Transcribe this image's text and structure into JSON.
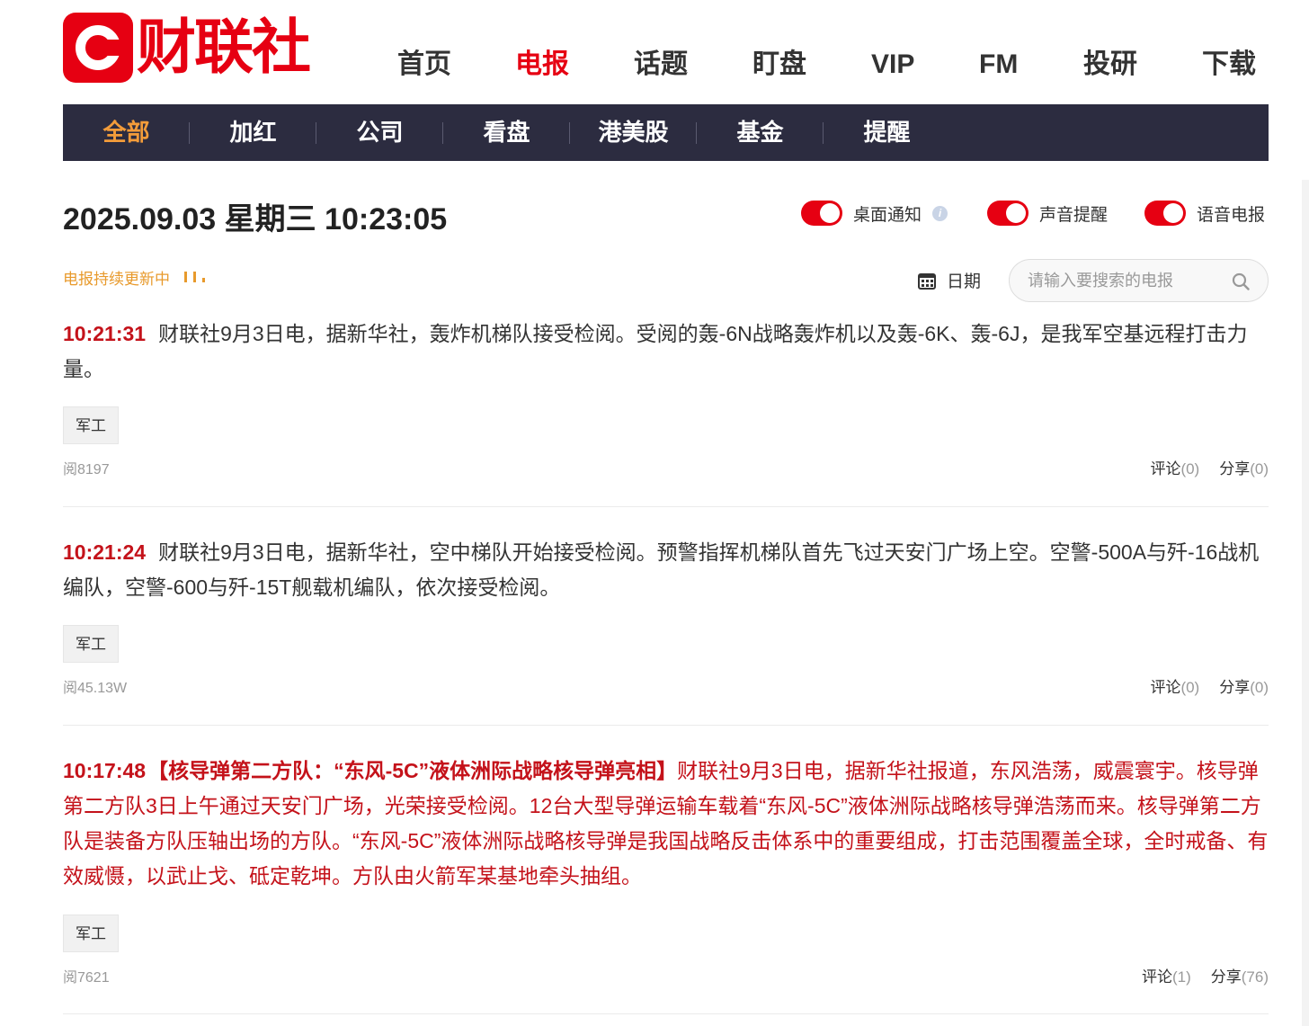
{
  "brand": {
    "name": "财联社",
    "color": "#e60012"
  },
  "main_nav": [
    {
      "label": "首页"
    },
    {
      "label": "电报",
      "active": true
    },
    {
      "label": "话题"
    },
    {
      "label": "盯盘"
    },
    {
      "label": "VIP"
    },
    {
      "label": "FM"
    },
    {
      "label": "投研"
    },
    {
      "label": "下载"
    }
  ],
  "sub_nav": [
    {
      "label": "全部",
      "active": true
    },
    {
      "label": "加红"
    },
    {
      "label": "公司"
    },
    {
      "label": "看盘"
    },
    {
      "label": "港美股"
    },
    {
      "label": "基金"
    },
    {
      "label": "提醒"
    }
  ],
  "date_display": "2025.09.03 星期三 10:23:05",
  "toggles": [
    {
      "label": "桌面通知",
      "on": true,
      "has_info_icon": true
    },
    {
      "label": "声音提醒",
      "on": true
    },
    {
      "label": "语音电报",
      "on": true
    }
  ],
  "status": {
    "updating_text": "电报持续更新中"
  },
  "date_filter_label": "日期",
  "search": {
    "placeholder": "请输入要搜索的电报"
  },
  "telegrams": [
    {
      "time": "10:21:31",
      "headline": "",
      "text": "财联社9月3日电，据新华社，轰炸机梯队接受检阅。受阅的轰-6N战略轰炸机以及轰-6K、轰-6J，是我军空基远程打击力量。",
      "tag": "军工",
      "reads": "阅8197",
      "comment_label": "评论",
      "comment_count": "(0)",
      "share_label": "分享",
      "share_count": "(0)",
      "highlight": false
    },
    {
      "time": "10:21:24",
      "headline": "",
      "text": "财联社9月3日电，据新华社，空中梯队开始接受检阅。预警指挥机梯队首先飞过天安门广场上空。空警-500A与歼-16战机编队，空警-600与歼-15T舰载机编队，依次接受检阅。",
      "tag": "军工",
      "reads": "阅45.13W",
      "comment_label": "评论",
      "comment_count": "(0)",
      "share_label": "分享",
      "share_count": "(0)",
      "highlight": false
    },
    {
      "time": "10:17:48",
      "headline": "【核导弹第二方队：“东风-5C”液体洲际战略核导弹亮相】",
      "text": "财联社9月3日电，据新华社报道，东风浩荡，威震寰宇。核导弹第二方队3日上午通过天安门广场，光荣接受检阅。12台大型导弹运输车载着“东风-5C”液体洲际战略核导弹浩荡而来。核导弹第二方队是装备方队压轴出场的方队。“东风-5C”液体洲际战略核导弹是我国战略反击体系中的重要组成，打击范围覆盖全球，全时戒备、有效威慑，以武止戈、砥定乾坤。方队由火箭军某基地牵头抽组。",
      "tag": "军工",
      "reads": "阅7621",
      "comment_label": "评论",
      "comment_count": "(1)",
      "share_label": "分享",
      "share_count": "(76)",
      "highlight": true
    }
  ]
}
